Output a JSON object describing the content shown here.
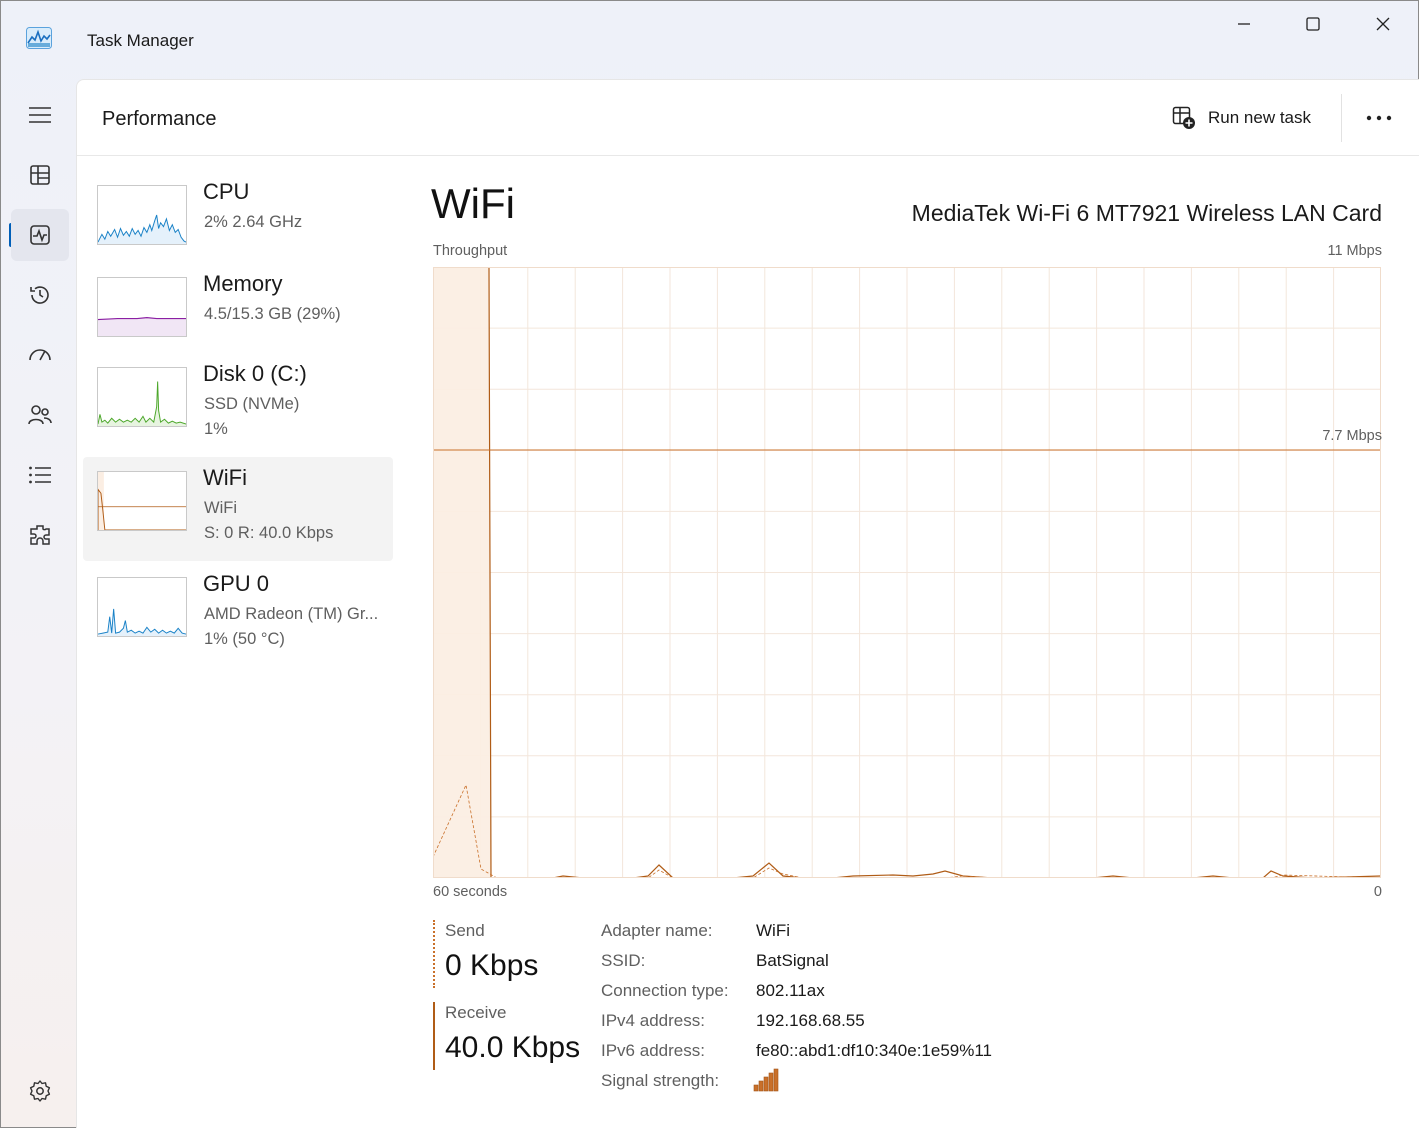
{
  "window": {
    "title": "Task Manager"
  },
  "nav": {
    "items": [
      {
        "icon": "hamburger-icon"
      },
      {
        "icon": "processes-icon"
      },
      {
        "icon": "performance-icon",
        "active": true
      },
      {
        "icon": "app-history-icon"
      },
      {
        "icon": "startup-apps-icon"
      },
      {
        "icon": "users-icon"
      },
      {
        "icon": "details-icon"
      },
      {
        "icon": "services-icon"
      }
    ],
    "settings_icon": "gear-icon"
  },
  "header": {
    "title": "Performance",
    "run_new_task": "Run new task",
    "more_icon": "more-icon"
  },
  "resources": [
    {
      "title": "CPU",
      "line1": "2%  2.64 GHz",
      "line2": "",
      "color": "#1a82c7"
    },
    {
      "title": "Memory",
      "line1": "4.5/15.3 GB (29%)",
      "line2": "",
      "color": "#8b1fa3"
    },
    {
      "title": "Disk 0 (C:)",
      "line1": "SSD (NVMe)",
      "line2": "1%",
      "color": "#4ca72a"
    },
    {
      "title": "WiFi",
      "line1": "WiFi",
      "line2": "S: 0  R: 40.0 Kbps",
      "color": "#b05c16",
      "selected": true
    },
    {
      "title": "GPU 0",
      "line1": "AMD Radeon (TM) Gr...",
      "line2": "1%  (50 °C)",
      "color": "#1a82c7"
    }
  ],
  "detail": {
    "title": "WiFi",
    "adapter": "MediaTek Wi-Fi 6 MT7921 Wireless LAN Card",
    "graph": {
      "y_label": "Throughput",
      "y_max_label": "11 Mbps",
      "ref_label": "7.7 Mbps",
      "x_left_label": "60 seconds",
      "x_right_label": "0"
    },
    "send": {
      "label": "Send",
      "value": "0 Kbps"
    },
    "receive": {
      "label": "Receive",
      "value": "40.0 Kbps"
    },
    "properties": [
      {
        "label": "Adapter name:",
        "value": "WiFi"
      },
      {
        "label": "SSID:",
        "value": "BatSignal"
      },
      {
        "label": "Connection type:",
        "value": "802.11ax"
      },
      {
        "label": "IPv4 address:",
        "value": "192.168.68.55"
      },
      {
        "label": "IPv6 address:",
        "value": "fe80::abd1:df10:340e:1e59%11"
      },
      {
        "label": "Signal strength:",
        "value": ""
      }
    ],
    "signal_bars_filled": 5,
    "accent": "#c9702a"
  }
}
